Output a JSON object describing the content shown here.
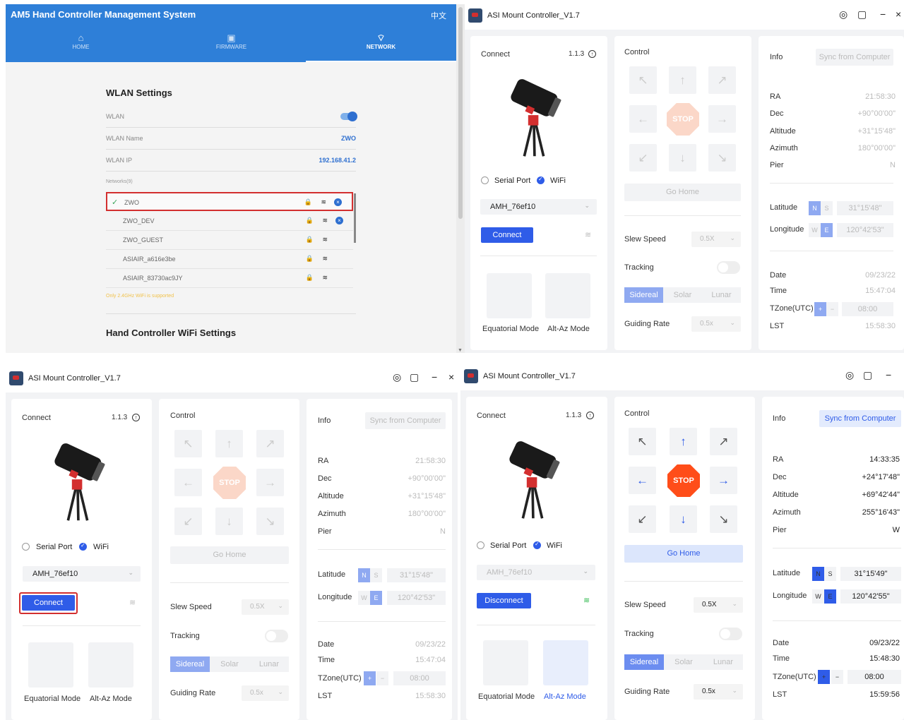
{
  "am5": {
    "title": "AM5 Hand Controller Management System",
    "lang": "中文",
    "nav": [
      {
        "label": "HOME"
      },
      {
        "label": "FIRMWARE"
      },
      {
        "label": "NETWORK"
      }
    ],
    "wlan_heading": "WLAN Settings",
    "wlan_label": "WLAN",
    "wlan_name_label": "WLAN Name",
    "wlan_name_value": "ZWO",
    "wlan_ip_label": "WLAN IP",
    "wlan_ip_value": "192.168.41.2",
    "networks_label": "Networks(9)",
    "networks": [
      {
        "name": "ZWO"
      },
      {
        "name": "ZWO_DEV"
      },
      {
        "name": "ZWO_GUEST"
      },
      {
        "name": "ASIAIR_a616e3be"
      },
      {
        "name": "ASIAIR_83730ac9JY"
      }
    ],
    "warning": "Only 2.4GHz WiFi is supported",
    "wifi_heading": "Hand Controller WiFi Settings"
  },
  "asi": {
    "app_title": "ASI Mount Controller_V1.7",
    "connect_label": "Connect",
    "version": "1.1.3",
    "serial_port_label": "Serial Port",
    "wifi_label": "WiFi",
    "device": "AMH_76ef10",
    "connect_button": "Connect",
    "disconnect_button": "Disconnect",
    "equatorial_mode": "Equatorial Mode",
    "altaz_mode": "Alt-Az Mode",
    "control_label": "Control",
    "stop_label": "STOP",
    "go_home": "Go Home",
    "slew_speed_label": "Slew Speed",
    "tracking_label": "Tracking",
    "tracking_modes": [
      "Sidereal",
      "Solar",
      "Lunar"
    ],
    "guiding_rate_label": "Guiding Rate",
    "info_label": "Info",
    "sync_button": "Sync from Computer",
    "ra_label": "RA",
    "dec_label": "Dec",
    "altitude_label": "Altitude",
    "azimuth_label": "Azimuth",
    "pier_label": "Pier",
    "latitude_label": "Latitude",
    "longitude_label": "Longitude",
    "north": "N",
    "south": "S",
    "west": "W",
    "east": "E",
    "date_label": "Date",
    "time_label": "Time",
    "tzone_label": "TZone(UTC)",
    "lst_label": "LST",
    "plus": "+",
    "minus": "−"
  },
  "disconnected": {
    "slew_speed": "0.5X",
    "guiding_rate": "0.5x",
    "ra": "21:58:30",
    "dec": "+90°00'00\"",
    "altitude": "+31°15'48\"",
    "azimuth": "180°00'00\"",
    "pier": "N",
    "latitude": "31°15'48\"",
    "longitude": "120°42'53\"",
    "date": "09/23/22",
    "time": "15:47:04",
    "tzone": "08:00",
    "lst": "15:58:30"
  },
  "connected": {
    "slew_speed": "0.5X",
    "guiding_rate": "0.5x",
    "ra": "14:33:35",
    "dec": "+24°17'48\"",
    "altitude": "+69°42'44\"",
    "azimuth": "255°16'43\"",
    "pier": "W",
    "latitude": "31°15'49\"",
    "longitude": "120°42'55\"",
    "date": "09/23/22",
    "time": "15:48:30",
    "tzone": "08:00",
    "lst": "15:59:56"
  },
  "colors": {
    "accent": "#2f5ce8",
    "stop": "#ff4d19",
    "header_blue": "#2e7fd8",
    "alert_red": "#d32f2f"
  }
}
